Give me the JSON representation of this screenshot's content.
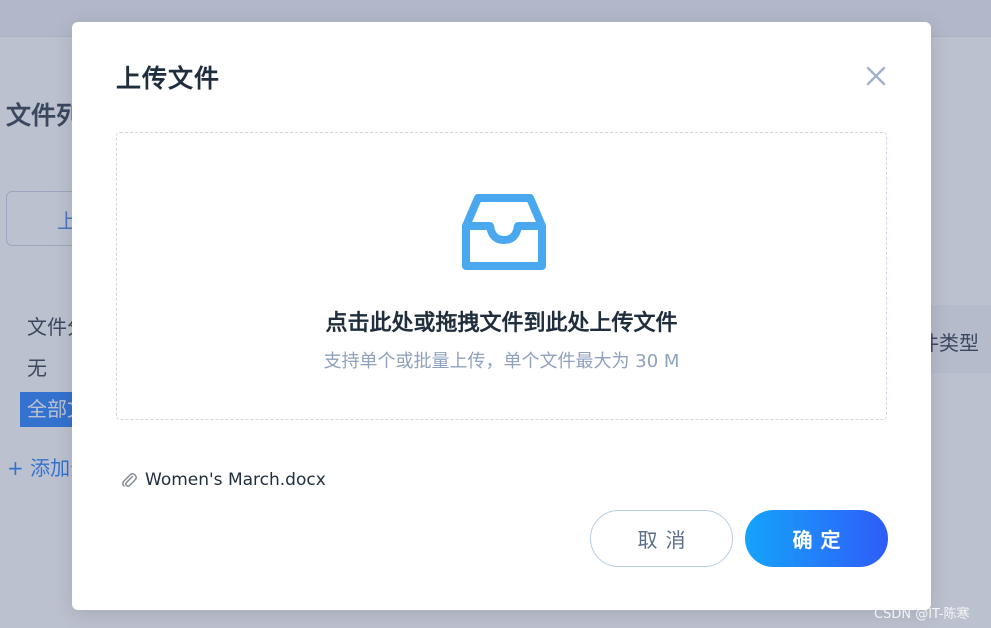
{
  "background": {
    "title": "文件列",
    "upload_button": "上",
    "category_label": "文件分",
    "none_label": "无",
    "all_item": "全部文",
    "add_link": "+ 添加分",
    "right_column_header": "件类型"
  },
  "modal": {
    "title": "上传文件",
    "close_icon": "close-icon",
    "dropzone": {
      "icon": "inbox-icon",
      "main_text": "点击此处或拖拽文件到此处上传文件",
      "hint_text": "支持单个或批量上传，单个文件最大为 30 M"
    },
    "files": [
      {
        "name": "Women's March.docx",
        "icon": "paperclip-icon"
      }
    ],
    "cancel_label": "取消",
    "confirm_label": "确定"
  },
  "watermark": "CSDN @IT-陈寒",
  "colors": {
    "accent": "#1677ff",
    "icon_blue": "#4aa8ef",
    "gradient_start": "#15a4fb",
    "gradient_end": "#2f5cf9",
    "hint_text": "#8fa1bd"
  }
}
